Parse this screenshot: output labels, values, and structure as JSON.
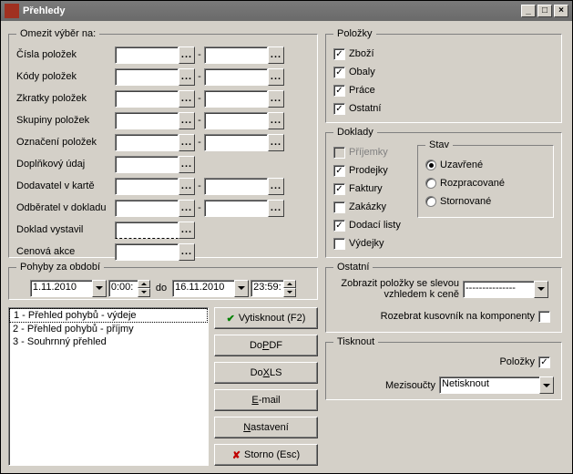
{
  "window": {
    "title": "Přehledy",
    "minimize": "_",
    "maximize": "□",
    "close": "×"
  },
  "limit": {
    "legend": "Omezit výběr na:",
    "rows": {
      "cisla": "Čísla položek",
      "kody": "Kódy položek",
      "zkratky": "Zkratky položek",
      "skupiny": "Skupiny položek",
      "oznaceni": "Označení položek",
      "doplnkovy": "Doplňkový údaj",
      "dodavatel": "Dodavatel v kartě",
      "odberatel": "Odběratel v dokladu",
      "doklad_vystavil": "Doklad vystavil",
      "cenova_akce": "Cenová akce"
    },
    "dotdot": "...",
    "dash": "-"
  },
  "period": {
    "legend": "Pohyby za období",
    "date_from": "1.11.2010",
    "time_from": "0:00:",
    "to_label": "do",
    "date_to": "16.11.2010",
    "time_to": "23:59:"
  },
  "reports": {
    "items": [
      "1 - Přehled pohybů - výdeje",
      "2 - Přehled pohybů - příjmy",
      "3 - Souhrnný přehled"
    ]
  },
  "buttons": {
    "print": "Vytisknout (F2)",
    "pdf_pre": "Do ",
    "pdf_u": "P",
    "pdf_post": "DF",
    "xls_pre": "Do ",
    "xls_u": "X",
    "xls_post": "LS",
    "email_u": "E",
    "email_post": "-mail",
    "nastaveni_u": "N",
    "nastaveni_post": "astavení",
    "storno": "Storno (Esc)"
  },
  "polozky": {
    "legend": "Položky",
    "zbozi": "Zboží",
    "obaly": "Obaly",
    "prace": "Práce",
    "ostatni": "Ostatní"
  },
  "stav": {
    "legend": "Stav",
    "uzavrene": "Uzavřené",
    "rozpracovane": "Rozpracované",
    "stornovane": "Stornované"
  },
  "doklady": {
    "legend": "Doklady",
    "prijemky": "Příjemky",
    "prodejky": "Prodejky",
    "faktury": "Faktury",
    "zakazky": "Zakázky",
    "dodaci": "Dodací listy",
    "vydejky": "Výdejky"
  },
  "ostatni": {
    "legend": "Ostatní",
    "sleva_label": "Zobrazit položky se slevou vzhledem k ceně",
    "sleva_value": "---------------",
    "kusovnik": "Rozebrat kusovník na komponenty"
  },
  "tisknout": {
    "legend": "Tisknout",
    "polozky_label": "Položky",
    "mezisoucty_label": "Mezisoučty",
    "mezisoucty_value": "Netisknout"
  }
}
